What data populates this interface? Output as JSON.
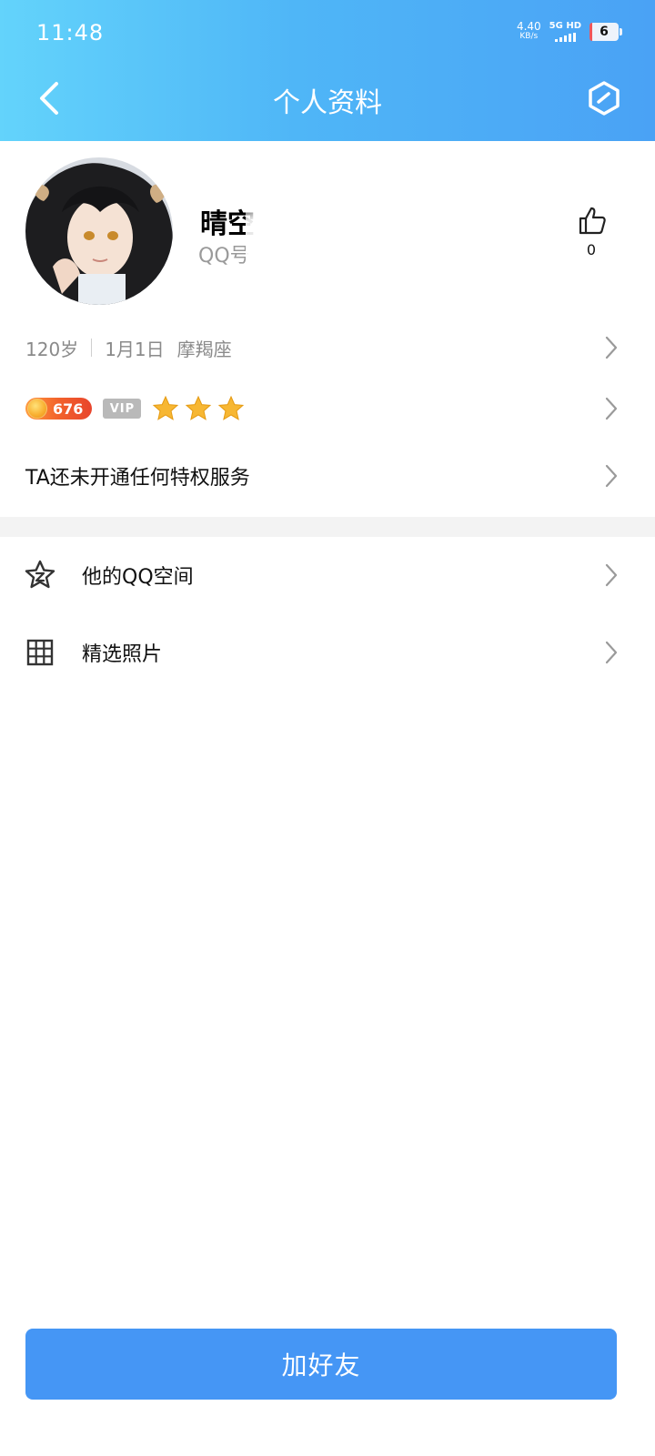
{
  "status_bar": {
    "time": "11:48",
    "net_speed": "4.40",
    "net_unit": "KB/s",
    "network": "5G HD",
    "battery": "6"
  },
  "header": {
    "title": "个人资料",
    "back_icon": "chevron-left-icon",
    "settings_icon": "hexagon-edit-icon"
  },
  "profile": {
    "nickname": "晴空",
    "qq_label": "QQ号",
    "likes": "0",
    "age": "120岁",
    "birthday": "1月1日",
    "zodiac": "摩羯座",
    "level_number": "676",
    "vip_label": "VIP",
    "star_count": 3,
    "privilege_text": "TA还未开通任何特权服务"
  },
  "menu": [
    {
      "label": "他的QQ空间",
      "icon": "star-space-icon"
    },
    {
      "label": "精选照片",
      "icon": "grid-icon"
    }
  ],
  "actions": {
    "add_friend": "加好友"
  },
  "colors": {
    "header_start": "#63d3fb",
    "header_end": "#4aa2f5",
    "button": "#4596f5"
  }
}
